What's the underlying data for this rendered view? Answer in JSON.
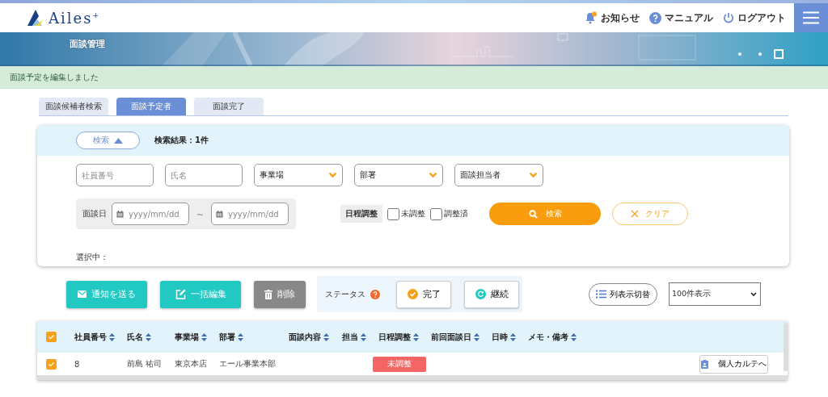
{
  "header": {
    "logo": "Ailes$^{+}$",
    "links": [
      {
        "kind": "notice",
        "label": "お知らせ"
      },
      {
        "kind": "help",
        "label": "マニュアル"
      },
      {
        "kind": "logout",
        "label": "ログアウト"
      }
    ]
  },
  "banner": {
    "title": "面談管理",
    "kind": "picture"
  },
  "alert": {
    "message": "面談予定を編集しました"
  },
  "tabs": [
    {
      "label": "面談候補者検索",
      "selected": false
    },
    {
      "label": "面談予定者",
      "selected": true
    },
    {
      "label": "面談完了",
      "selected": false
    }
  ],
  "search": {
    "toggle": "検索",
    "expanded": true,
    "result": "検索結果：1件",
    "fields": [
      {
        "kind": "text",
        "placeholder": "社員番号"
      },
      {
        "kind": "text",
        "placeholder": "氏名"
      },
      {
        "kind": "select",
        "label": "事業場"
      },
      {
        "kind": "select",
        "label": "部署"
      },
      {
        "kind": "select",
        "label": "面談担当者"
      }
    ],
    "date": {
      "label": "面談日",
      "from_placeholder": "yyyy/mm/dd",
      "separator": "～",
      "to_placeholder": "yyyy/mm/dd"
    },
    "schedule": {
      "label": "日程調整",
      "options": [
        {
          "label": "未調整",
          "checked": false
        },
        {
          "label": "調整済",
          "checked": false
        }
      ]
    },
    "search_button": "検索",
    "clear_button": "クリア",
    "selected_label": "選択中："
  },
  "actions": [
    {
      "kind": "mail",
      "label": "通知を送る"
    },
    {
      "kind": "edit",
      "label": "一括編集"
    },
    {
      "kind": "delete",
      "label": "削除"
    }
  ],
  "status": {
    "label": "ステータス",
    "buttons": [
      {
        "kind": "done",
        "label": "完了"
      },
      {
        "kind": "continue",
        "label": "継続"
      }
    ]
  },
  "columns_button": "列表示切替",
  "page_size": "100件表示",
  "table": {
    "all_selected": true,
    "columns": [
      "社員番号",
      "氏名",
      "事業場",
      "部署",
      "面談内容",
      "担当",
      "日程調整",
      "前回面談日",
      "日時",
      "メモ・備考"
    ],
    "rows": [
      {
        "selected": true,
        "cells": [
          "8",
          "前島 祐司",
          "東京本店",
          "エール事業本部"
        ],
        "schedule": "未調整",
        "action": "個人カルテへ"
      }
    ]
  }
}
